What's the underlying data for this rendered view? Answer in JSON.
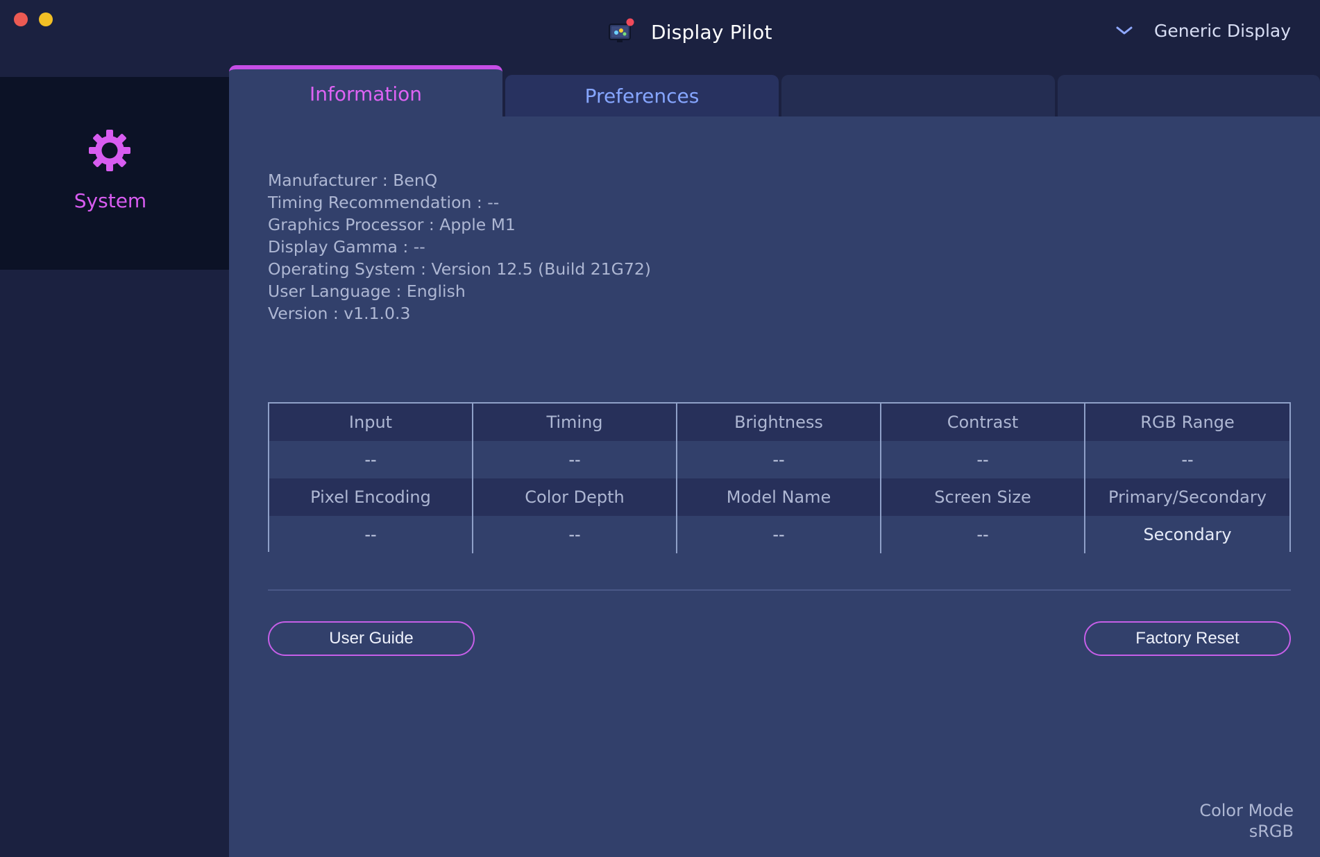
{
  "window": {
    "title": "Display Pilot"
  },
  "header": {
    "display_selector": "Generic Display",
    "dropdown_icon": "chevron-down-icon",
    "app_icon": "display-pilot-logo-icon"
  },
  "sidebar": {
    "items": [
      {
        "label": "System",
        "icon": "gear-icon",
        "selected": true
      }
    ]
  },
  "tabs": [
    {
      "label": "Information",
      "active": true
    },
    {
      "label": "Preferences",
      "active": false
    },
    {
      "label": "",
      "active": false
    },
    {
      "label": "",
      "active": false
    }
  ],
  "info": {
    "lines": [
      "Manufacturer : BenQ",
      "Timing Recommendation : --",
      "Graphics Processor : Apple M1",
      "Display Gamma : --",
      "Operating System : Version 12.5 (Build 21G72)",
      "User Language : English",
      "Version : v1.1.0.3"
    ]
  },
  "table": {
    "rows": [
      {
        "headers": [
          "Input",
          "Timing",
          "Brightness",
          "Contrast",
          "RGB Range"
        ],
        "values": [
          "--",
          "--",
          "--",
          "--",
          "--"
        ]
      },
      {
        "headers": [
          "Pixel Encoding",
          "Color Depth",
          "Model Name",
          "Screen Size",
          "Primary/Secondary"
        ],
        "values": [
          "--",
          "--",
          "--",
          "--",
          "Secondary"
        ]
      }
    ]
  },
  "buttons": {
    "user_guide": "User Guide",
    "factory_reset": "Factory Reset"
  },
  "status": {
    "color_mode_label": "Color Mode",
    "color_mode_value": "sRGB"
  },
  "colors": {
    "accent": "#de63f4",
    "tab_link": "#86a6ff",
    "panel": "#32406b",
    "background": "#1b2140"
  }
}
